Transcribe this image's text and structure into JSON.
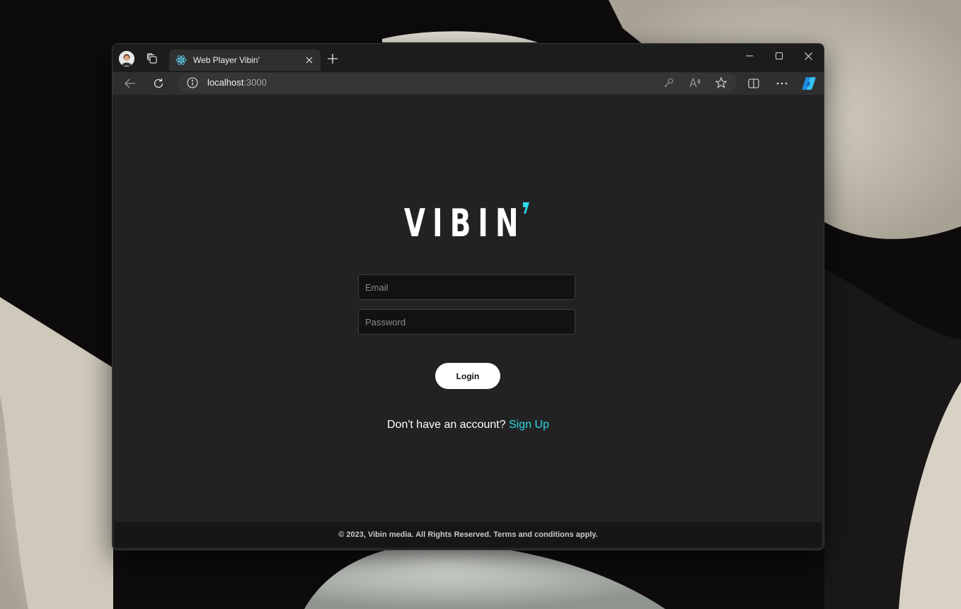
{
  "browser": {
    "tab_title": "Web Player Vibin'",
    "url_host": "localhost",
    "url_port": ":3000",
    "icons": {
      "profile": "profile-avatar-icon",
      "workspaces": "workspaces-icon",
      "tab_favicon": "react-icon",
      "tab_close": "close-icon",
      "new_tab": "plus-icon",
      "minimize": "minimize-icon",
      "maximize": "maximize-icon",
      "close_window": "close-icon",
      "back": "back-arrow-icon",
      "refresh": "refresh-icon",
      "site_info": "info-icon",
      "password": "key-icon",
      "read_aloud": "read-aloud-icon",
      "favorite": "star-icon",
      "split_screen": "split-screen-icon",
      "more": "more-dots-icon",
      "copilot": "copilot-icon"
    }
  },
  "page": {
    "logo_text": "VIBIN",
    "logo_accent_color": "#2fd9e6",
    "email_placeholder": "Email",
    "password_placeholder": "Password",
    "login_label": "Login",
    "signup_prompt": "Don't have an account?",
    "signup_link": "Sign Up",
    "footer_text": "© 2023, Vibin media. All Rights Reserved. Terms and conditions apply."
  }
}
